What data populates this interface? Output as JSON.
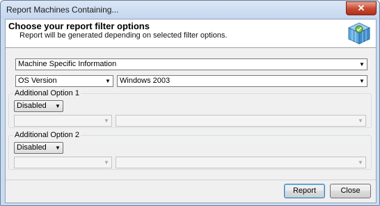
{
  "window": {
    "title": "Report Machines Containing...",
    "close_glyph": "✕"
  },
  "header": {
    "title": "Choose your report filter options",
    "subtitle": "Report will be generated depending on selected filter options.",
    "icon": "report-cube-icon"
  },
  "category": {
    "value": "Machine Specific Information"
  },
  "filter": {
    "field": "OS Version",
    "value": "Windows 2003"
  },
  "option1": {
    "legend": "Additional Option 1",
    "state": "Disabled",
    "field": "",
    "value": ""
  },
  "option2": {
    "legend": "Additional Option 2",
    "state": "Disabled",
    "field": "",
    "value": ""
  },
  "buttons": {
    "report": "Report",
    "close": "Close"
  },
  "colors": {
    "accent": "#3c7fb1",
    "close_red": "#c6472f",
    "frame": "#c9dbf0"
  }
}
